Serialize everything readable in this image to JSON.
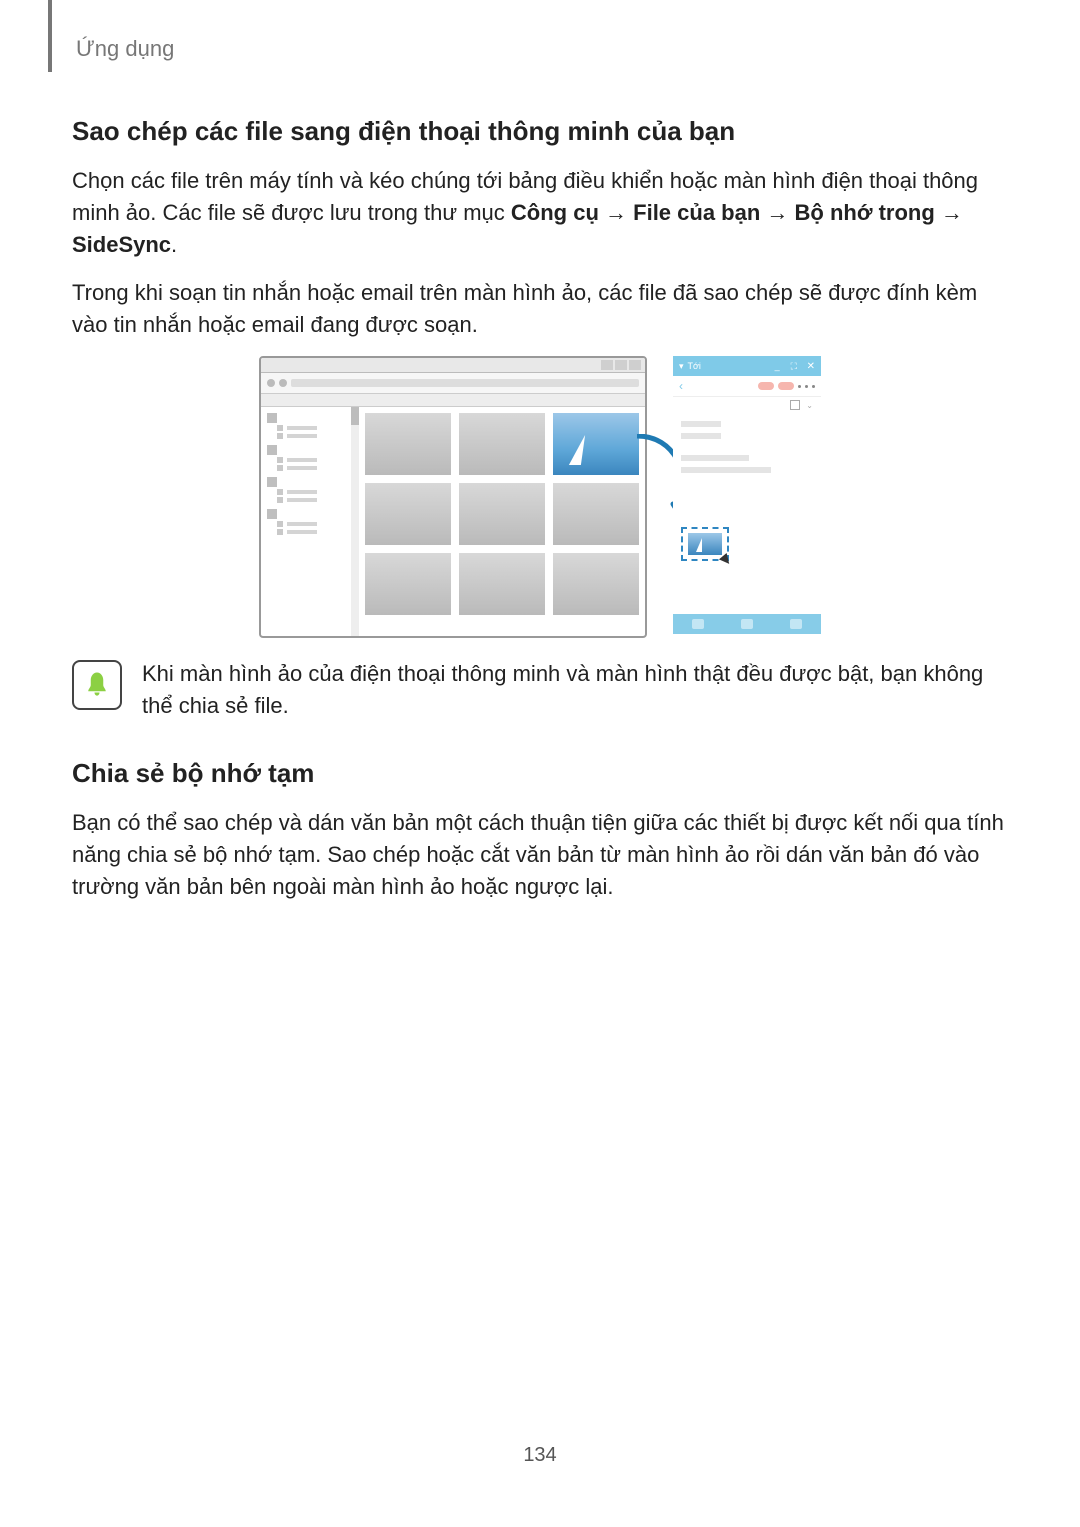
{
  "header": {
    "section": "Ứng dụng"
  },
  "section1": {
    "title": "Sao chép các file sang điện thoại thông minh của bạn",
    "para1_pre": "Chọn các file trên máy tính và kéo chúng tới bảng điều khiển hoặc màn hình điện thoại thông minh ảo. Các file sẽ được lưu trong thư mục ",
    "breadcrumb1": "Công cụ",
    "arrow": " → ",
    "breadcrumb2": "File của bạn",
    "breadcrumb3": "Bộ nhớ trong",
    "breadcrumb4": "SideSync",
    "period": ".",
    "para2": "Trong khi soạn tin nhắn hoặc email trên màn hình ảo, các file đã sao chép sẽ được đính kèm vào tin nhắn hoặc email đang được soạn."
  },
  "note": {
    "text": "Khi màn hình ảo của điện thoại thông minh và màn hình thật đều được bật, bạn không thể chia sẻ file."
  },
  "section2": {
    "title": "Chia sẻ bộ nhớ tạm",
    "para1": "Bạn có thể sao chép và dán văn bản một cách thuận tiện giữa các thiết bị được kết nối qua tính năng chia sẻ bộ nhớ tạm. Sao chép hoặc cắt văn bản từ màn hình ảo rồi dán văn bản đó vào trường văn bản bên ngoài màn hình ảo hoặc ngược lại."
  },
  "figure": {
    "phone_title": "Tới"
  },
  "page_number": "134"
}
